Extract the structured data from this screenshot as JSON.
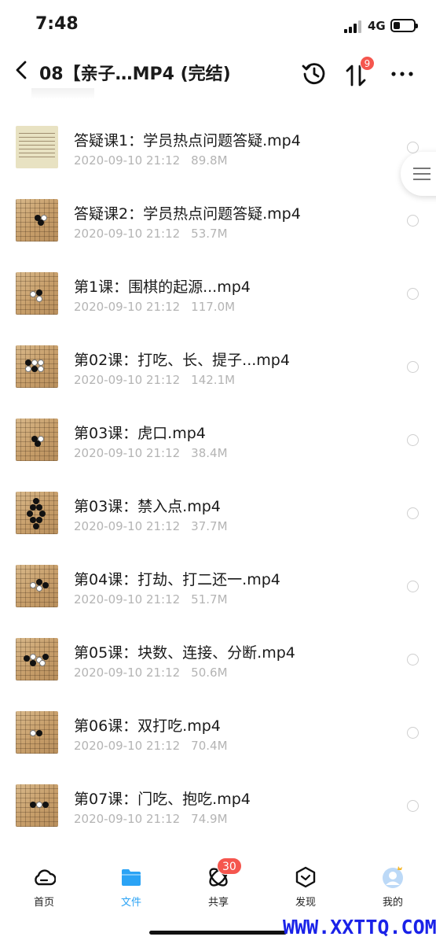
{
  "status_bar": {
    "time": "7:48",
    "network": "4G",
    "battery_level": 0.35
  },
  "header": {
    "title": "08【亲子…MP4 (完结)",
    "transfer_badge": "9"
  },
  "files": [
    {
      "name": "答疑课1：学员热点问题答疑.mp4",
      "date": "2020-09-10 21:12",
      "size": "89.8M",
      "thumb": "text-page-thumbnail"
    },
    {
      "name": "答疑课2：学员热点问题答疑.mp4",
      "date": "2020-09-10 21:12",
      "size": "53.7M",
      "thumb": "go-board-thumbnail"
    },
    {
      "name": "第1课：围棋的起源...mp4",
      "date": "2020-09-10 21:12",
      "size": "117.0M",
      "thumb": "go-board-thumbnail"
    },
    {
      "name": "第02课：打吃、长、提子...mp4",
      "date": "2020-09-10 21:12",
      "size": "142.1M",
      "thumb": "go-board-thumbnail"
    },
    {
      "name": "第03课：虎口.mp4",
      "date": "2020-09-10 21:12",
      "size": "38.4M",
      "thumb": "go-board-thumbnail"
    },
    {
      "name": "第03课：禁入点.mp4",
      "date": "2020-09-10 21:12",
      "size": "37.7M",
      "thumb": "go-board-thumbnail"
    },
    {
      "name": "第04课：打劫、打二还一.mp4",
      "date": "2020-09-10 21:12",
      "size": "51.7M",
      "thumb": "go-board-thumbnail"
    },
    {
      "name": "第05课：块数、连接、分断.mp4",
      "date": "2020-09-10 21:12",
      "size": "50.6M",
      "thumb": "go-board-thumbnail"
    },
    {
      "name": "第06课：双打吃.mp4",
      "date": "2020-09-10 21:12",
      "size": "70.4M",
      "thumb": "go-board-thumbnail"
    },
    {
      "name": "第07课：门吃、抱吃.mp4",
      "date": "2020-09-10 21:12",
      "size": "74.9M",
      "thumb": "go-board-thumbnail"
    }
  ],
  "bottom_nav": {
    "items": [
      {
        "label": "首页",
        "icon": "cloud-icon"
      },
      {
        "label": "文件",
        "icon": "folder-icon",
        "active": true
      },
      {
        "label": "共享",
        "icon": "share-orbit-icon",
        "badge": "30"
      },
      {
        "label": "发现",
        "icon": "discover-icon"
      },
      {
        "label": "我的",
        "icon": "avatar-icon"
      }
    ]
  },
  "watermark": "WWW.XXTTQ.COM",
  "colors": {
    "accent": "#2aa3f5",
    "badge": "#f5564e",
    "meta_text": "#b4b4b4",
    "watermark": "#1a22e8"
  }
}
